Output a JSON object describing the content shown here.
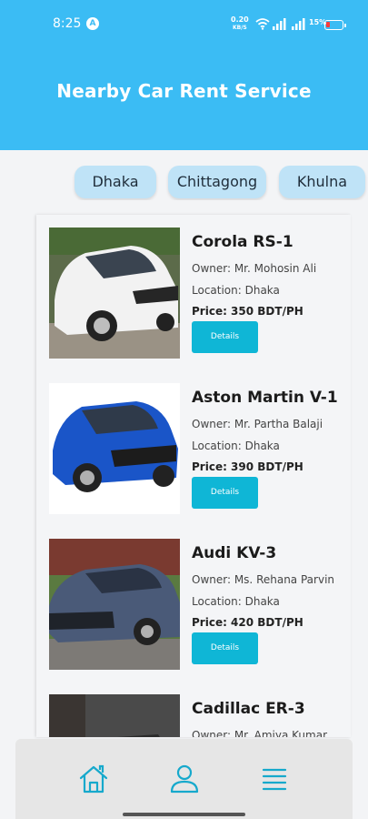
{
  "status_bar": {
    "time": "8:25",
    "net_speed_value": "0.20",
    "net_speed_unit": "KB/S",
    "battery_pct": "15%"
  },
  "header": {
    "title": "Nearby Car Rent Service"
  },
  "cities": [
    "Dhaka",
    "Chittagong",
    "Khulna"
  ],
  "cars": [
    {
      "name": "Corola RS-1",
      "owner": "Owner: Mr.  Mohosin Ali",
      "location": "Location: Dhaka",
      "price": "Price:  350 BDT/PH",
      "button": "Details"
    },
    {
      "name": "Aston Martin V-1",
      "owner": "Owner: Mr.  Partha Balaji",
      "location": "Location: Dhaka",
      "price": "Price:  390 BDT/PH",
      "button": "Details"
    },
    {
      "name": "Audi KV-3",
      "owner": "Owner: Ms.  Rehana Parvin",
      "location": "Location: Dhaka",
      "price": "Price:  420 BDT/PH",
      "button": "Details"
    },
    {
      "name": "Cadillac ER-3",
      "owner": "Owner: Mr.  Amiya Kumar",
      "location": "",
      "price": "",
      "button": ""
    }
  ],
  "colors": {
    "primary": "#3bbcf4",
    "chip_bg": "#bfe3f7",
    "button": "#0fb6d6",
    "nav_icon": "#16a9cc"
  },
  "nav": {
    "icons": [
      "home-icon",
      "user-icon",
      "menu-icon"
    ]
  }
}
